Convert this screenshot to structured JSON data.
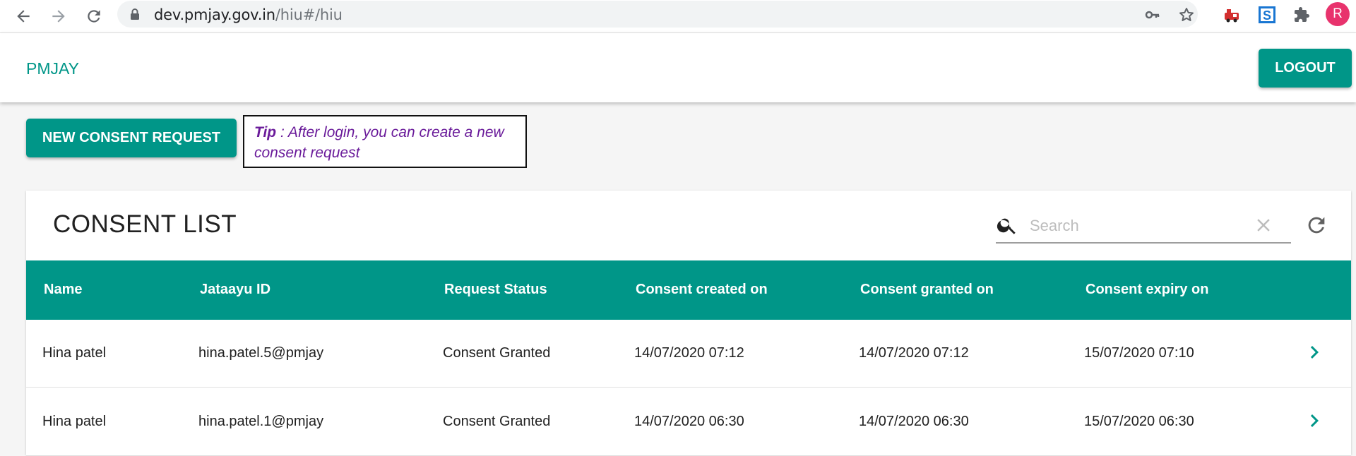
{
  "browser": {
    "url_host": "dev.pmjay.gov.in",
    "url_path": "/hiu#/hiu",
    "avatar_letter": "R",
    "icons": [
      "back-icon",
      "forward-icon",
      "reload-icon",
      "lock-icon",
      "key-icon",
      "star-icon",
      "extension-train-icon",
      "extension-s-icon",
      "puzzle-icon"
    ]
  },
  "header": {
    "brand": "PMJAY",
    "logout_label": "LOGOUT"
  },
  "actions": {
    "new_request_label": "NEW CONSENT REQUEST",
    "tip_label": "Tip",
    "tip_text": " : After login, you can create a new consent request"
  },
  "consent_list": {
    "title": "CONSENT LIST",
    "search_placeholder": "Search",
    "columns": [
      "Name",
      "Jataayu ID",
      "Request Status",
      "Consent created on",
      "Consent granted on",
      "Consent expiry on"
    ],
    "rows": [
      {
        "name": "Hina patel",
        "id": "hina.patel.5@pmjay",
        "status": "Consent Granted",
        "created": "14/07/2020 07:12",
        "granted": "14/07/2020 07:12",
        "expiry": "15/07/2020 07:10"
      },
      {
        "name": "Hina patel",
        "id": "hina.patel.1@pmjay",
        "status": "Consent Granted",
        "created": "14/07/2020 06:30",
        "granted": "14/07/2020 06:30",
        "expiry": "15/07/2020 06:30"
      }
    ]
  },
  "colors": {
    "primary": "#009688",
    "tip_text": "#6a1b9a",
    "avatar": "#e8336d"
  }
}
